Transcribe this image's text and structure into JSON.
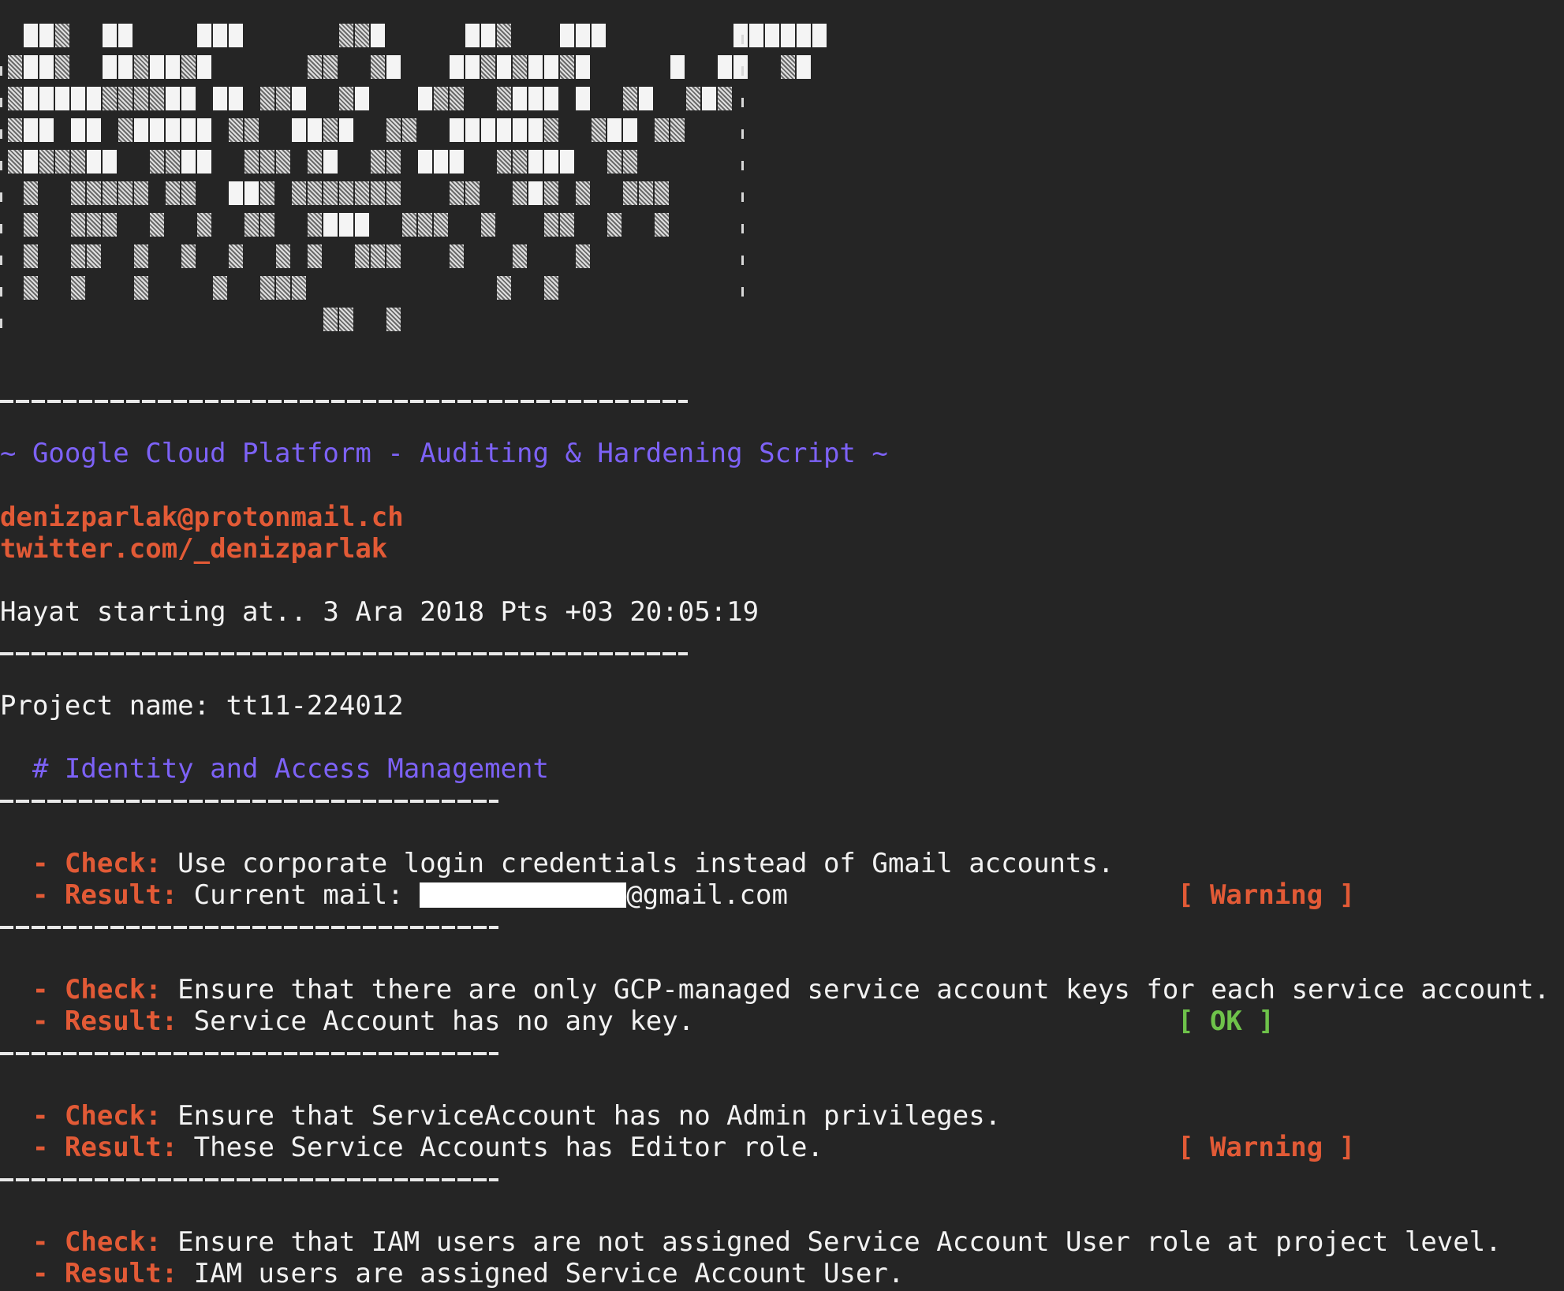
{
  "header": {
    "title": "~ Google Cloud Platform - Auditing & Hardening Script ~",
    "email": "denizparlak@protonmail.ch",
    "twitter": "twitter.com/_denizparlak",
    "start_line": "Hayat starting at.. 3 Ara 2018 Pts +03 20:05:19"
  },
  "project": {
    "line": "Project name: tt11-224012"
  },
  "section": {
    "title": "  # Identity and Access Management"
  },
  "labels": {
    "check": "  - Check:",
    "result": "  - Result:"
  },
  "checks": [
    {
      "check": " Use corporate login credentials instead of Gmail accounts.",
      "result_prefix": " Current mail: ",
      "result_suffix": "@gmail.com",
      "status": "[ Warning ]"
    },
    {
      "check": " Ensure that there are only GCP-managed service account keys for each service account.",
      "result": " Service Account has no any key.",
      "status": "[ OK ]"
    },
    {
      "check": " Ensure that ServiceAccount has no Admin privileges.",
      "result": " These Service Accounts has Editor role.",
      "status": "[ Warning ]"
    },
    {
      "check": " Ensure that IAM users are not assigned Service Account User role at project level.",
      "result": " IAM users are assigned Service Account User."
    }
  ],
  "colors": {
    "background": "#252525",
    "accent_purple": "#7d62f7",
    "accent_orange": "#e25a36",
    "ok_green": "#6ec24a"
  }
}
